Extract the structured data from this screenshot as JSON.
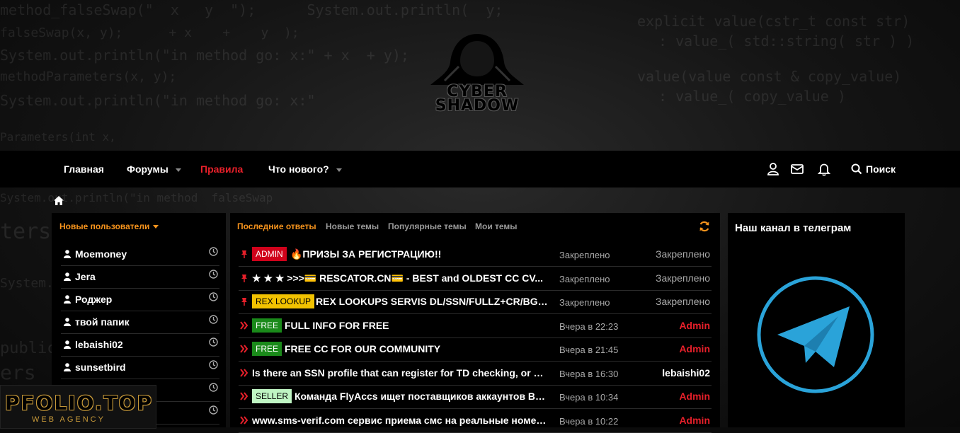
{
  "header": {
    "logo_text_line1": "CYBER",
    "logo_text_line2": "SHADOW"
  },
  "nav": {
    "items": [
      {
        "label": "Главная"
      },
      {
        "label": "Форумы"
      },
      {
        "label": "Правила"
      },
      {
        "label": "Что нового?"
      }
    ],
    "search_label": "Поиск",
    "icons": [
      "user-icon",
      "envelope-icon",
      "bell-icon",
      "search-icon"
    ]
  },
  "new_users": {
    "title": "Новые пользователи",
    "users": [
      "Moemoney",
      "Jera",
      "Роджер",
      "твой папик",
      "lebaishi02",
      "sunsetbird",
      "",
      ""
    ]
  },
  "threads": {
    "tabs": [
      "Последние ответы",
      "Новые темы",
      "Популярные темы",
      "Мои темы"
    ],
    "items": [
      {
        "icon": "pin-icon",
        "badge": "ADMIN",
        "title": "🔥ПРИЗЫ ЗА РЕГИСТРАЦИЮ!!",
        "date": "Закреплено",
        "last": "Закреплено"
      },
      {
        "icon": "pin-icon",
        "badge": "",
        "title": "★ ★ ★ >>>💳 RESCATOR.CN💳  - BEST and OLDEST CC CV...",
        "date": "Закреплено",
        "last": "Закреплено"
      },
      {
        "icon": "pin-icon",
        "badge": "REX LOOKUP",
        "title": "REX LOOKUPS SERVIS DL/SSN/FULLZ+CR/BG/D...",
        "date": "Закреплено",
        "last": "Закреплено"
      },
      {
        "icon": "arrows-icon",
        "badge": "FREE",
        "title": "FULL INFO FOR FREE",
        "date": "Вчера в 22:23",
        "last": "Admin"
      },
      {
        "icon": "arrows-icon",
        "badge": "FREE",
        "title": "FREE CC FOR OUR COMMUNITY",
        "date": "Вчера в 21:45",
        "last": "Admin"
      },
      {
        "icon": "arrows-icon",
        "badge": "",
        "title": "Is there an SSN profile that can register for TD checking, or wh...",
        "date": "Вчера в 16:30",
        "last": "lebaishi02"
      },
      {
        "icon": "arrows-icon",
        "badge": "SELLER",
        "title": "Команда FlyAccs ищет поставщиков аккаунтов ВК | ...",
        "date": "Вчера в 10:34",
        "last": "Admin"
      },
      {
        "icon": "arrows-icon",
        "badge": "",
        "title": "www.sms-verif.com сервис приема смс на реальные номера...",
        "date": "Вчера в 10:22",
        "last": "Admin"
      }
    ]
  },
  "telegram": {
    "title": "Наш канал в телеграм"
  },
  "watermark": {
    "main": "PFOLIO.TOP",
    "sub": "WEB AGENCY"
  },
  "colors": {
    "accent_orange": "#f7941d",
    "accent_red": "#e8202a",
    "telegram_blue": "#2aa3d9",
    "badge_admin": "#d0021b",
    "badge_rex": "#f2c200",
    "badge_free": "#1a8a1a",
    "badge_seller": "#bff5c3"
  }
}
